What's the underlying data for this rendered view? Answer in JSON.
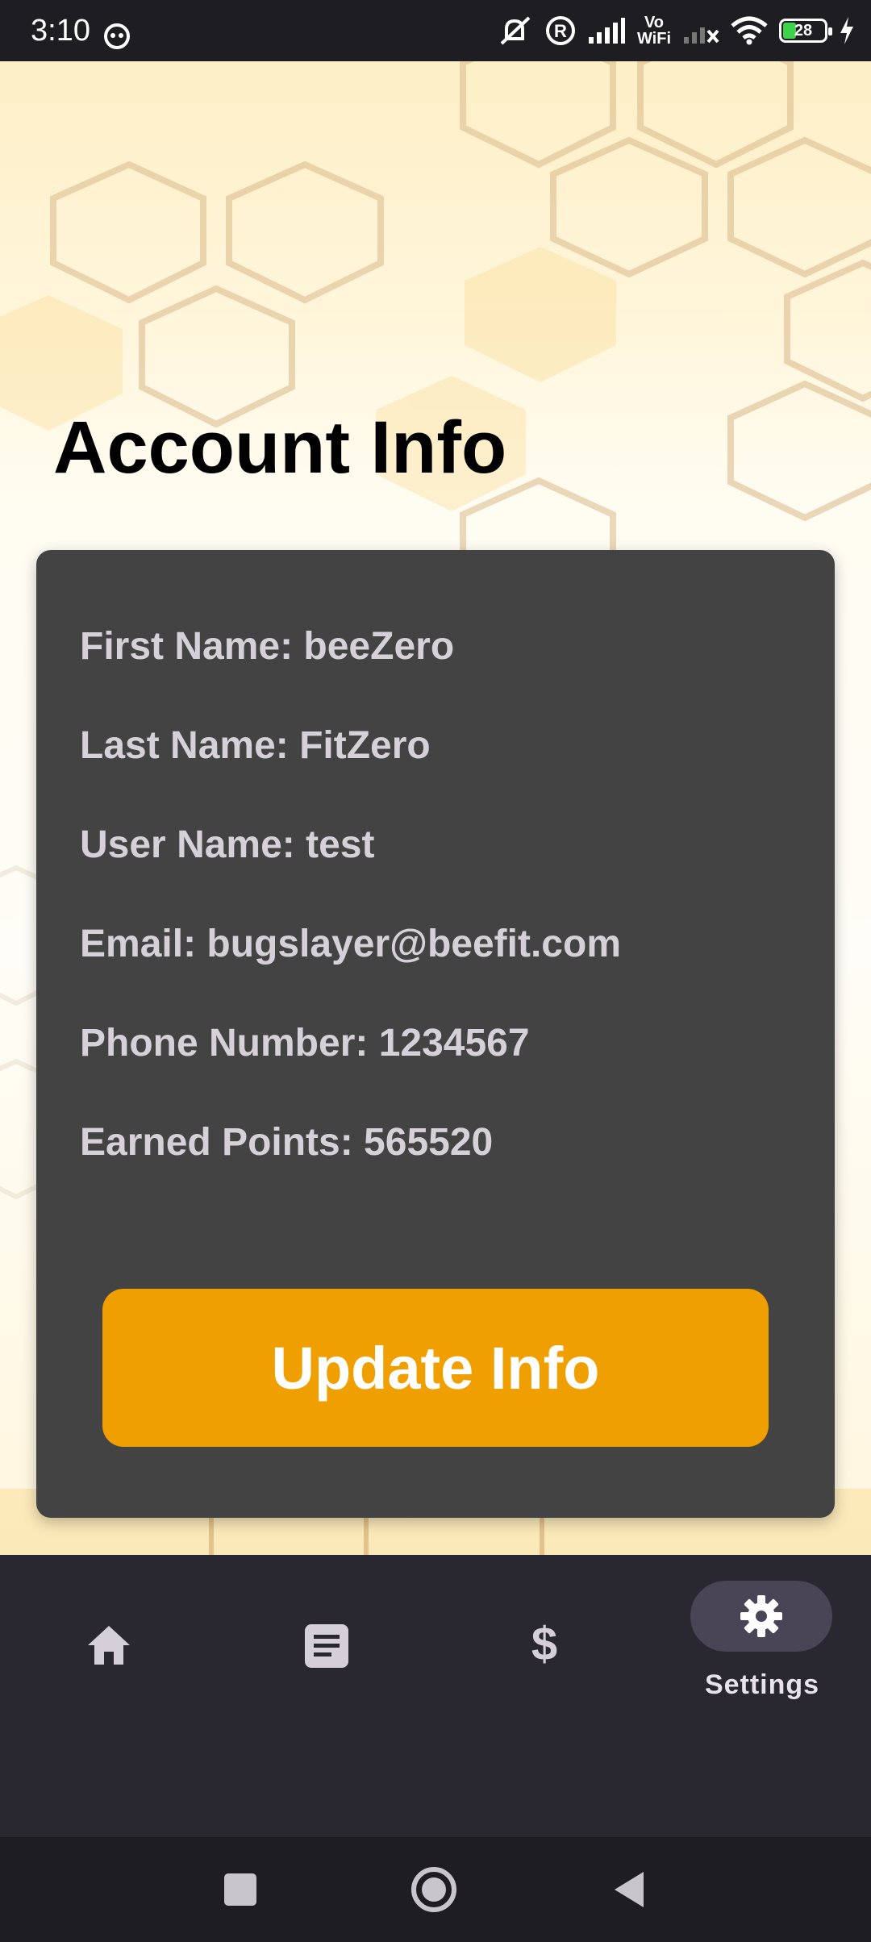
{
  "status_bar": {
    "time": "3:10",
    "network_label_top": "Vo",
    "network_label_bottom": "WiFi",
    "battery": "28",
    "icons": [
      "notification-face-icon",
      "mute-icon",
      "registered-icon",
      "signal-icon",
      "vowifi-icon",
      "no-signal-icon",
      "wifi-icon",
      "battery-icon",
      "charging-icon"
    ]
  },
  "page": {
    "title": "Account Info"
  },
  "account": {
    "first_name": "First Name: beeZero",
    "last_name": "Last Name: FitZero",
    "user_name": "User Name: test",
    "email": "Email: bugslayer@beefit.com",
    "phone": "Phone Number: 1234567",
    "points": "Earned Points: 565520"
  },
  "actions": {
    "update_label": "Update Info"
  },
  "bottom_nav": {
    "items": [
      {
        "icon": "home-icon"
      },
      {
        "icon": "article-icon"
      },
      {
        "icon": "dollar-icon",
        "glyph": "$"
      },
      {
        "icon": "gear-icon",
        "label": "Settings",
        "active": true
      }
    ]
  },
  "system_nav": {
    "buttons": [
      "recents-icon",
      "home-circle-icon",
      "back-icon"
    ]
  },
  "colors": {
    "accent": "#f09f00",
    "card": "#434343",
    "nav_bg": "#29272f",
    "active_pill": "#4a4556"
  }
}
